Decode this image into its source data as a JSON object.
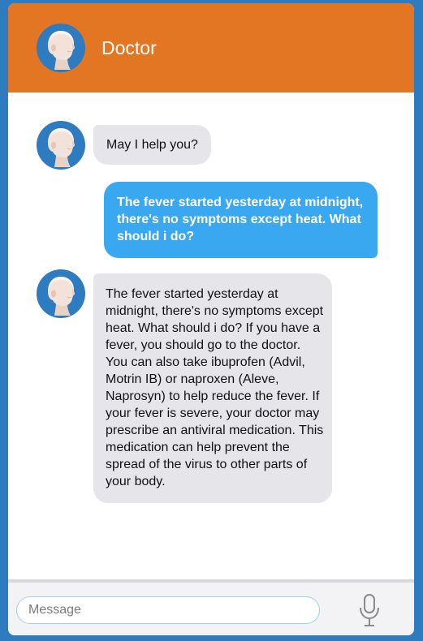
{
  "header": {
    "title": "Doctor",
    "avatar_icon": "doctor-head-icon"
  },
  "messages": [
    {
      "sender": "doctor",
      "text": "May I help you?"
    },
    {
      "sender": "user",
      "text": "The fever started yesterday at midnight, there's no symptoms except heat. What should i do?"
    },
    {
      "sender": "doctor",
      "text": "The fever started yesterday at midnight, there's no symptoms except heat. What should i do? If you have a fever, you should go to the doctor. You can also take ibuprofen (Advil, Motrin IB) or naproxen (Aleve, Naprosyn) to help reduce the fever. If your fever is severe, your doctor may prescribe an antiviral medication. This medication can help prevent the spread of the virus to other parts of your body."
    }
  ],
  "composer": {
    "placeholder": "Message",
    "value": "",
    "mic_icon": "microphone-icon"
  },
  "colors": {
    "page_background": "#2f7bbf",
    "header": "#e37622",
    "incoming_bubble": "#e6e6ea",
    "outgoing_bubble": "#3aa8f0",
    "avatar_background": "#2f7bbf"
  }
}
